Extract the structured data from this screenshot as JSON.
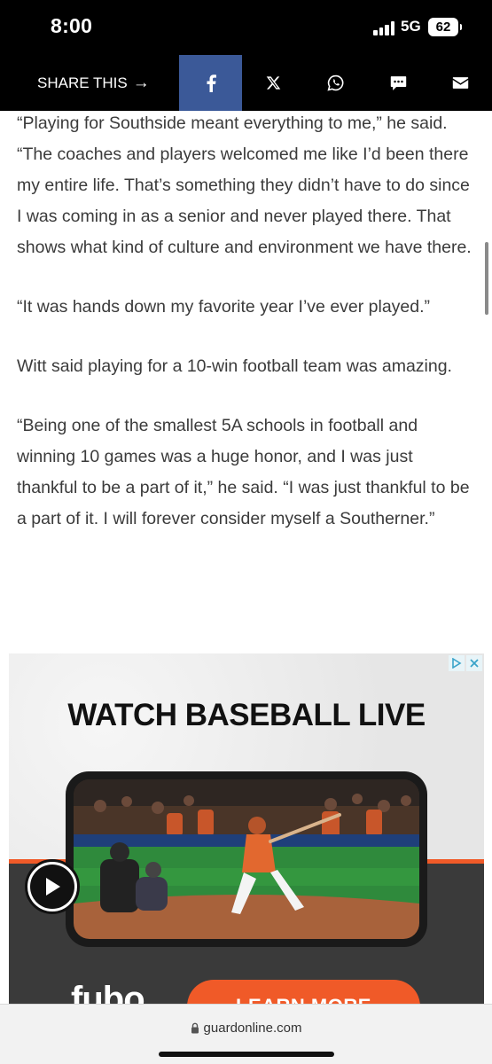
{
  "status_bar": {
    "time": "8:00",
    "network": "5G",
    "battery": "62"
  },
  "share_bar": {
    "label": "SHARE THIS",
    "arrow": "→",
    "buttons": [
      {
        "name": "facebook",
        "icon": "facebook-icon"
      },
      {
        "name": "x",
        "icon": "x-icon"
      },
      {
        "name": "whatsapp",
        "icon": "whatsapp-icon"
      },
      {
        "name": "sms",
        "icon": "message-icon"
      },
      {
        "name": "email",
        "icon": "mail-icon"
      }
    ],
    "facebook_color": "#3b5998"
  },
  "article": {
    "paragraphs": [
      "“Playing for Southside meant everything to me,” he said. “The coaches and players welcomed me like I’d been there my entire life. That’s something they didn’t have to do since I was coming in as a senior and never played there. That shows what kind of culture and environment we have there.",
      "“It was hands down my favorite year I’ve ever played.”",
      "Witt said playing for a 10-win football team was amazing.",
      "“Being one of the smallest 5A schools in football and winning 10 games was a huge honor, and I was just thankful to be a part of it,” he said. “I was just thankful to be a part of it. I will forever consider myself a Southerner.”"
    ]
  },
  "ad": {
    "headline": "WATCH BASEBALL LIVE",
    "brand": "fubo",
    "cta": "LEARN MORE",
    "accent_color": "#f05a28"
  },
  "browser": {
    "url": "guardonline.com"
  }
}
